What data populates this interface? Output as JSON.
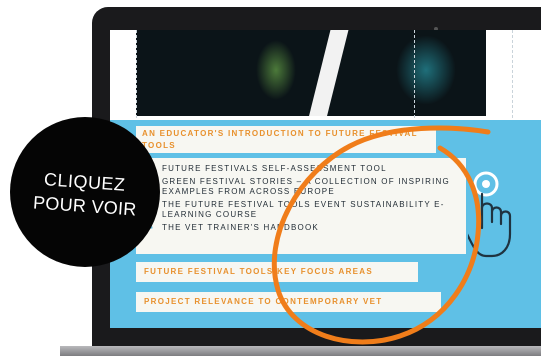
{
  "badge": {
    "line1": "CLIQUEZ",
    "line2": "POUR VOIR"
  },
  "slide": {
    "heading": "AN EDUCATOR'S INTRODUCTION TO FUTURE FESTIVAL TOOLS",
    "items": [
      "FUTURE FESTIVALS SELF-ASSESSMENT TOOL",
      "GREEN FESTIVAL STORIES – A COLLECTION OF INSPIRING EXAMPLES FROM ACROSS EUROPE",
      "THE FUTURE FESTIVAL TOOLS EVENT SUSTAINABILITY E-LEARNING COURSE",
      "THE VET TRAINER'S HANDBOOK"
    ],
    "bullet": "▪",
    "link1": "FUTURE FESTIVAL TOOLS KEY FOCUS AREAS",
    "link2": "PROJECT RELEVANCE TO CONTEMPORARY VET"
  },
  "icons": {
    "hand": "hand-pointer-icon",
    "annotation": "orange-circle-annotation"
  },
  "colors": {
    "panel_blue": "#5fc0e6",
    "accent_orange": "#e8912e",
    "annotation_orange": "#f07d1a",
    "badge_black": "#050505",
    "bezel": "#1a1a1c"
  }
}
